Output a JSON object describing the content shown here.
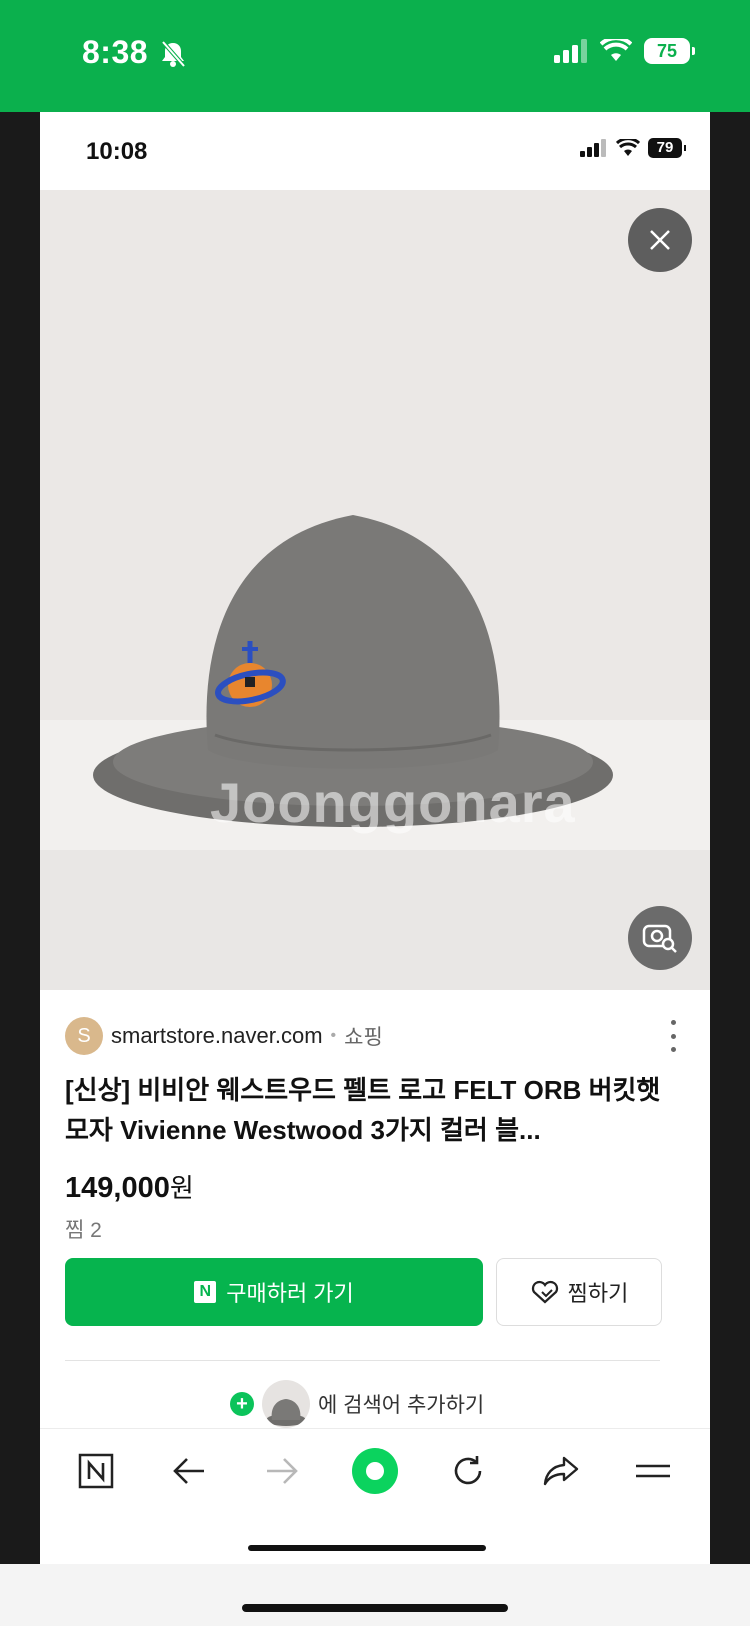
{
  "outer_status": {
    "time": "8:38",
    "battery": "75"
  },
  "inner_status": {
    "time": "10:08",
    "battery": "79"
  },
  "image": {
    "watermark": "Joonggonara"
  },
  "seller": {
    "initial": "S",
    "name": "smartstore.naver.com",
    "category": "쇼핑"
  },
  "product": {
    "title": "[신상] 비비안 웨스트우드 펠트 로고 FELT ORB 버킷햇 모자 Vivienne Westwood 3가지 컬러 블...",
    "price": "149,000",
    "currency": "원",
    "likes": "찜 2"
  },
  "actions": {
    "buy_logo": "N",
    "buy_label": "구매하러 가기",
    "wish_label": "찜하기"
  },
  "search_add": {
    "label": "에 검색어 추가하기"
  },
  "bottom_nav": {
    "naver_label": "N"
  },
  "colors": {
    "status_green": "#0bb04d",
    "buy_green": "#06b44e",
    "orb_blue": "#2b4fc0",
    "orb_orange": "#e8862e"
  },
  "icons": [
    "bell-off-icon",
    "signal-icon",
    "wifi-icon",
    "close-icon",
    "image-search-icon",
    "more-vertical-icon",
    "heart-icon",
    "plus-icon",
    "back-arrow-icon",
    "forward-arrow-icon",
    "green-dot-icon",
    "refresh-icon",
    "share-icon",
    "menu-icon"
  ]
}
